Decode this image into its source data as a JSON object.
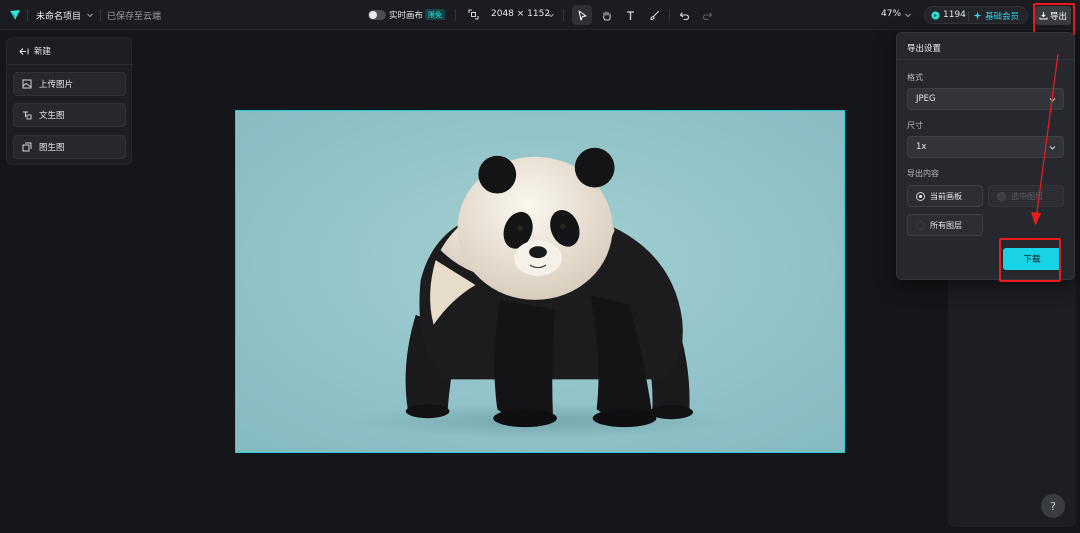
{
  "topbar": {
    "project_name": "未命名项目",
    "save_status": "已保存至云端",
    "realtime_label": "实时画布",
    "free_badge": "限免",
    "canvas_size": "2048 × 1152",
    "zoom": "47%",
    "credits": "1194",
    "membership": "基础会员",
    "export_label": "导出"
  },
  "left_panel": {
    "new_label": "新建",
    "items": [
      {
        "label": "上传图片",
        "icon": "upload-image-icon"
      },
      {
        "label": "文生图",
        "icon": "text-to-image-icon"
      },
      {
        "label": "图生图",
        "icon": "image-to-image-icon"
      }
    ]
  },
  "export_panel": {
    "title": "导出设置",
    "format_label": "格式",
    "format_value": "JPEG",
    "size_label": "尺寸",
    "size_value": "1x",
    "content_label": "导出内容",
    "options": [
      {
        "label": "当前画板",
        "checked": true,
        "disabled": false
      },
      {
        "label": "选中图层",
        "checked": false,
        "disabled": true
      },
      {
        "label": "所有图层",
        "checked": false,
        "disabled": false
      }
    ],
    "download_label": "下载"
  },
  "help_label": "?",
  "colors": {
    "accent": "#18d2e6",
    "highlight": "#e81c1c",
    "background": "#15161a",
    "canvas_bg": "#8fc2c7"
  }
}
